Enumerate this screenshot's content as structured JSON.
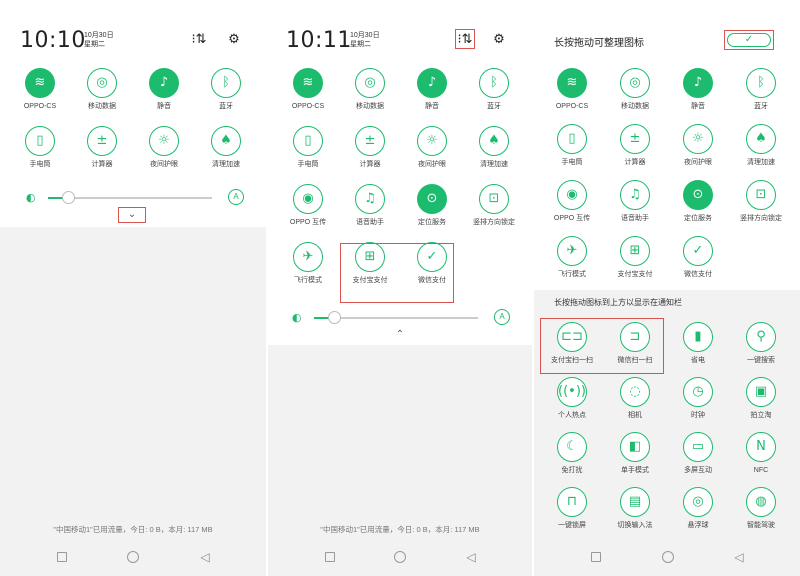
{
  "screens": [
    {
      "time": "10:10",
      "date": "10月30日",
      "weekday": "星期二",
      "tiles": [
        {
          "label": "OPPO-CS",
          "icon": "wifi-icon",
          "glyph": "≋",
          "on": true
        },
        {
          "label": "移动数据",
          "icon": "globe-icon",
          "glyph": "◎",
          "on": false
        },
        {
          "label": "静音",
          "icon": "mute-icon",
          "glyph": "♪",
          "on": true
        },
        {
          "label": "蓝牙",
          "icon": "bluetooth-icon",
          "glyph": "ᛒ",
          "on": false
        },
        {
          "label": "手电筒",
          "icon": "flashlight-icon",
          "glyph": "▯",
          "on": false
        },
        {
          "label": "计算器",
          "icon": "calculator-icon",
          "glyph": "±",
          "on": false
        },
        {
          "label": "夜间护眼",
          "icon": "eye-care-icon",
          "glyph": "☼",
          "on": false
        },
        {
          "label": "清理加速",
          "icon": "clean-icon",
          "glyph": "♠",
          "on": false
        }
      ],
      "brightness_auto": "A",
      "footer": "\"中国移动1\"已用流量，今日: 0 B，本月: 117 MB"
    },
    {
      "time": "10:11",
      "date": "10月30日",
      "weekday": "星期二",
      "tiles": [
        {
          "label": "OPPO-CS",
          "icon": "wifi-icon",
          "glyph": "≋",
          "on": true
        },
        {
          "label": "移动数据",
          "icon": "globe-icon",
          "glyph": "◎",
          "on": false
        },
        {
          "label": "静音",
          "icon": "mute-icon",
          "glyph": "♪",
          "on": true
        },
        {
          "label": "蓝牙",
          "icon": "bluetooth-icon",
          "glyph": "ᛒ",
          "on": false
        },
        {
          "label": "手电筒",
          "icon": "flashlight-icon",
          "glyph": "▯",
          "on": false
        },
        {
          "label": "计算器",
          "icon": "calculator-icon",
          "glyph": "±",
          "on": false
        },
        {
          "label": "夜间护眼",
          "icon": "eye-care-icon",
          "glyph": "☼",
          "on": false
        },
        {
          "label": "清理加速",
          "icon": "clean-icon",
          "glyph": "♠",
          "on": false
        },
        {
          "label": "OPPO 互传",
          "icon": "share-icon",
          "glyph": "◉",
          "on": false
        },
        {
          "label": "语音助手",
          "icon": "mic-icon",
          "glyph": "♫",
          "on": false
        },
        {
          "label": "定位服务",
          "icon": "location-icon",
          "glyph": "⊙",
          "on": true
        },
        {
          "label": "竖排方向锁定",
          "icon": "rotation-lock-icon",
          "glyph": "⊡",
          "on": false
        },
        {
          "label": "飞行模式",
          "icon": "airplane-icon",
          "glyph": "✈",
          "on": false
        },
        {
          "label": "支付宝支付",
          "icon": "alipay-icon",
          "glyph": "⊞",
          "on": false
        },
        {
          "label": "微信支付",
          "icon": "wechat-pay-icon",
          "glyph": "✓",
          "on": false
        }
      ],
      "brightness_auto": "A",
      "footer": "\"中国移动1\"已用流量，今日: 0 B，本月: 117 MB"
    },
    {
      "title": "长按拖动可整理图标",
      "confirm": "✓",
      "subtitle": "长按拖动图标到上方以显示在通知栏",
      "tiles": [
        {
          "label": "OPPO-CS",
          "icon": "wifi-icon",
          "glyph": "≋",
          "on": true
        },
        {
          "label": "移动数据",
          "icon": "globe-icon",
          "glyph": "◎",
          "on": false
        },
        {
          "label": "静音",
          "icon": "mute-icon",
          "glyph": "♪",
          "on": true
        },
        {
          "label": "蓝牙",
          "icon": "bluetooth-icon",
          "glyph": "ᛒ",
          "on": false
        },
        {
          "label": "手电筒",
          "icon": "flashlight-icon",
          "glyph": "▯",
          "on": false
        },
        {
          "label": "计算器",
          "icon": "calculator-icon",
          "glyph": "±",
          "on": false
        },
        {
          "label": "夜间护眼",
          "icon": "eye-care-icon",
          "glyph": "☼",
          "on": false
        },
        {
          "label": "清理加速",
          "icon": "clean-icon",
          "glyph": "♠",
          "on": false
        },
        {
          "label": "OPPO 互传",
          "icon": "share-icon",
          "glyph": "◉",
          "on": false
        },
        {
          "label": "语音助手",
          "icon": "mic-icon",
          "glyph": "♫",
          "on": false
        },
        {
          "label": "定位服务",
          "icon": "location-icon",
          "glyph": "⊙",
          "on": true
        },
        {
          "label": "竖排方向锁定",
          "icon": "rotation-lock-icon",
          "glyph": "⊡",
          "on": false
        },
        {
          "label": "飞行模式",
          "icon": "airplane-icon",
          "glyph": "✈",
          "on": false
        },
        {
          "label": "支付宝支付",
          "icon": "alipay-icon",
          "glyph": "⊞",
          "on": false
        },
        {
          "label": "微信支付",
          "icon": "wechat-pay-icon",
          "glyph": "✓",
          "on": false
        }
      ],
      "extra_tiles": [
        {
          "label": "支付宝扫一扫",
          "icon": "alipay-scan-icon",
          "glyph": "⊏⊐"
        },
        {
          "label": "微信扫一扫",
          "icon": "wechat-scan-icon",
          "glyph": "⊐"
        },
        {
          "label": "省电",
          "icon": "battery-saver-icon",
          "glyph": "▮"
        },
        {
          "label": "一键搜索",
          "icon": "search-icon",
          "glyph": "⚲"
        },
        {
          "label": "个人热点",
          "icon": "hotspot-icon",
          "glyph": "((•))"
        },
        {
          "label": "相机",
          "icon": "camera-icon",
          "glyph": "◌"
        },
        {
          "label": "时钟",
          "icon": "clock-icon",
          "glyph": "◷"
        },
        {
          "label": "拍立淘",
          "icon": "photo-search-icon",
          "glyph": "▣"
        },
        {
          "label": "免打扰",
          "icon": "do-not-disturb-icon",
          "glyph": "☾"
        },
        {
          "label": "单手模式",
          "icon": "one-hand-icon",
          "glyph": "◧"
        },
        {
          "label": "多屏互动",
          "icon": "multi-screen-icon",
          "glyph": "▭"
        },
        {
          "label": "NFC",
          "icon": "nfc-icon",
          "glyph": "N"
        },
        {
          "label": "一键锁屏",
          "icon": "lock-icon",
          "glyph": "⊓"
        },
        {
          "label": "切换输入法",
          "icon": "keyboard-icon",
          "glyph": "▤"
        },
        {
          "label": "悬浮球",
          "icon": "float-ball-icon",
          "glyph": "◎"
        },
        {
          "label": "智能驾驶",
          "icon": "driving-icon",
          "glyph": "◍"
        }
      ]
    }
  ]
}
